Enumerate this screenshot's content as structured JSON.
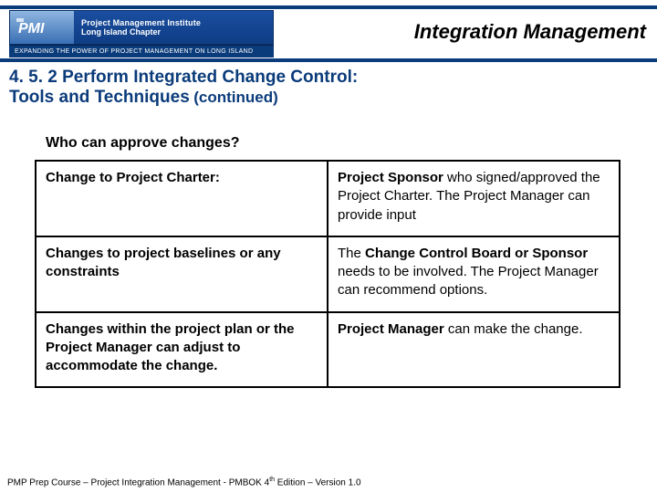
{
  "logo": {
    "line1": "Project Management Institute",
    "line2": "Long Island Chapter",
    "tagline": "EXPANDING THE POWER OF PROJECT MANAGEMENT ON LONG ISLAND"
  },
  "header": {
    "title": "Integration Management"
  },
  "section": {
    "number_title": "4. 5. 2 Perform Integrated Change Control:",
    "subtitle": "Tools and Techniques",
    "continued": "(continued)"
  },
  "question": "Who can approve changes?",
  "table": {
    "rows": [
      {
        "left": "Change to Project Charter:",
        "right_bold": "Project Sponsor",
        "right_rest": " who signed/approved the Project Charter.  The Project Manager can provide input"
      },
      {
        "left": "Changes to project baselines or any constraints",
        "right_pre": "The ",
        "right_bold": "Change Control Board or Sponsor",
        "right_rest": " needs to be involved. The Project Manager can recommend options."
      },
      {
        "left": "Changes within the project plan or the Project Manager can adjust to accommodate the change.",
        "right_bold": "Project Manager",
        "right_rest": " can make the change."
      }
    ]
  },
  "footer": {
    "text_pre": "PMP Prep Course – Project Integration Management - PMBOK 4",
    "sup": "th",
    "text_post": " Edition – Version 1.0"
  }
}
